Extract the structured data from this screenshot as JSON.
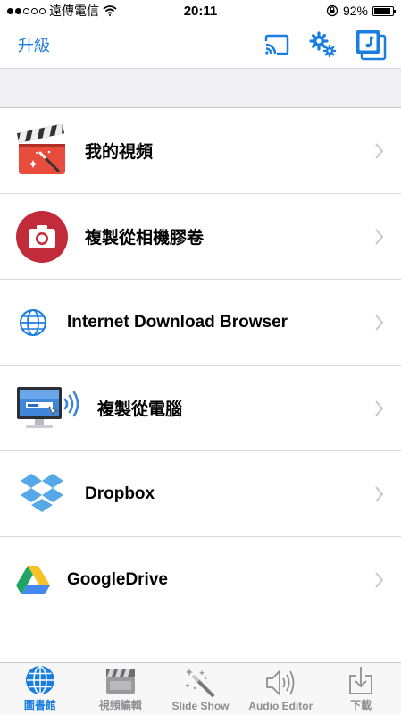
{
  "status_bar": {
    "carrier": "遠傳電信",
    "time": "20:11",
    "battery_percent": "92%",
    "battery_level": 0.92
  },
  "navbar": {
    "upgrade_label": "升級"
  },
  "menu": {
    "items": [
      {
        "label": "我的視頻",
        "icon": "clapperboard-icon"
      },
      {
        "label": "複製從相機膠卷",
        "icon": "camera-icon"
      },
      {
        "label": "Internet Download Browser",
        "icon": "globe-icon"
      },
      {
        "label": "複製從電腦",
        "icon": "computer-wifi-icon"
      },
      {
        "label": "Dropbox",
        "icon": "dropbox-icon"
      },
      {
        "label": "GoogleDrive",
        "icon": "google-drive-icon"
      }
    ]
  },
  "tabbar": {
    "tabs": [
      {
        "label": "圖書館",
        "icon": "globe-icon",
        "active": true
      },
      {
        "label": "視頻編輯",
        "icon": "clapperboard-icon",
        "active": false
      },
      {
        "label": "Slide Show",
        "icon": "magic-wand-icon",
        "active": false
      },
      {
        "label": "Audio Editor",
        "icon": "speaker-icon",
        "active": false
      },
      {
        "label": "下載",
        "icon": "download-icon",
        "active": false
      }
    ]
  },
  "colors": {
    "accent": "#1a7de0",
    "separator": "#d9d9de",
    "band": "#efeff4"
  }
}
